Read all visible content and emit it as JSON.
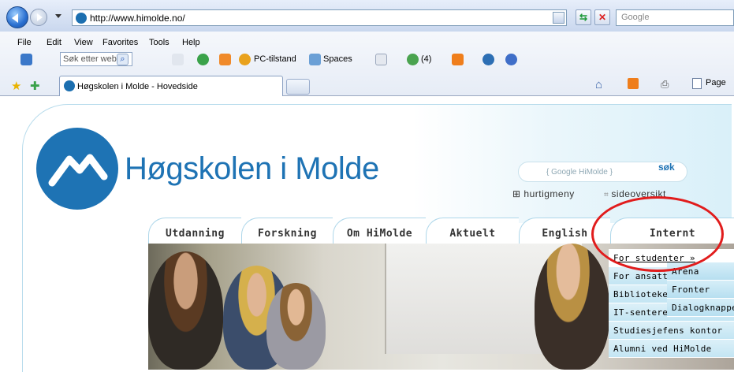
{
  "browser": {
    "url": "http://www.himolde.no/",
    "search_placeholder": "Google",
    "menu": [
      "File",
      "Edit",
      "View",
      "Favorites",
      "Tools",
      "Help"
    ],
    "toolbar": {
      "search_field": "Søk etter web",
      "pc_status": "PC-tilstand",
      "spaces": "Spaces",
      "people_count": "(4)"
    },
    "tab_title": "Høgskolen i Molde - Hovedside",
    "command_page": "Page"
  },
  "site": {
    "brand": "Høgskolen i Molde",
    "search_placeholder": "{ Google HiMolde }",
    "search_button": "søk",
    "quickmenu": "hurtigmeny",
    "sitemap": "sideoversikt",
    "nav": [
      "Utdanning",
      "Forskning",
      "Om HiMolde",
      "Aktuelt",
      "English",
      "Internt"
    ],
    "dropdown": [
      "For studenter »",
      "For ansatte",
      "Biblioteket",
      "IT-senteret",
      "Studiesjefens kontor",
      "Alumni ved HiMolde"
    ],
    "submenu": [
      "Arena",
      "Fronter",
      "Dialogknapper"
    ]
  },
  "colors": {
    "brand": "#1e73b4",
    "highlight": "#e11c1c"
  }
}
